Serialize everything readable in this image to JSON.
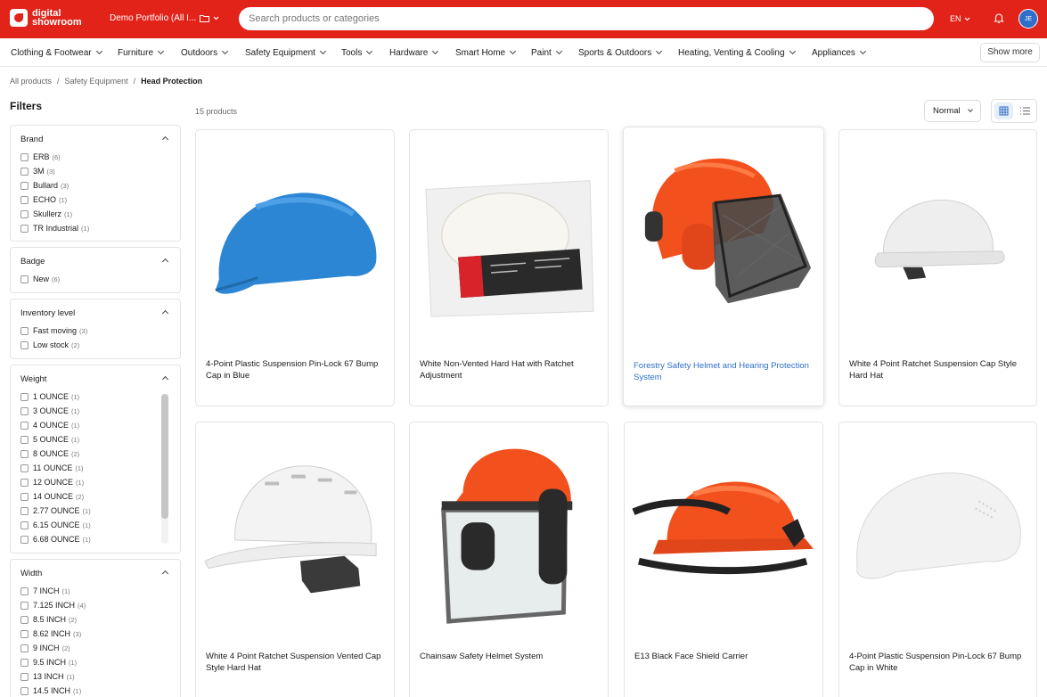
{
  "app": {
    "logo_line1": "digital",
    "logo_line2": "showroom",
    "portfolio": "Demo Portfolio (All I...",
    "search_placeholder": "Search products or categories",
    "language": "EN",
    "avatar_initials": "JE",
    "brand_color": "#e2231a"
  },
  "nav": {
    "categories": [
      "Clothing & Footwear",
      "Furniture",
      "Outdoors",
      "Safety Equipment",
      "Tools",
      "Hardware",
      "Smart Home",
      "Paint",
      "Sports & Outdoors",
      "Heating, Venting & Cooling",
      "Appliances"
    ],
    "show_more": "Show more"
  },
  "breadcrumb": {
    "items": [
      "All products",
      "Safety Equipment",
      "Head Protection"
    ],
    "separator": "/"
  },
  "filters": {
    "title": "Filters",
    "brand": {
      "title": "Brand",
      "options": [
        {
          "label": "ERB",
          "count": "(6)"
        },
        {
          "label": "3M",
          "count": "(3)"
        },
        {
          "label": "Bullard",
          "count": "(3)"
        },
        {
          "label": "ECHO",
          "count": "(1)"
        },
        {
          "label": "Skullerz",
          "count": "(1)"
        },
        {
          "label": "TR Industrial",
          "count": "(1)"
        }
      ]
    },
    "badge": {
      "title": "Badge",
      "options": [
        {
          "label": "New",
          "count": "(6)"
        }
      ]
    },
    "inventory": {
      "title": "Inventory level",
      "options": [
        {
          "label": "Fast moving",
          "count": "(3)"
        },
        {
          "label": "Low stock",
          "count": "(2)"
        }
      ]
    },
    "weight": {
      "title": "Weight",
      "options": [
        {
          "label": "1 OUNCE",
          "count": "(1)"
        },
        {
          "label": "3 OUNCE",
          "count": "(1)"
        },
        {
          "label": "4 OUNCE",
          "count": "(1)"
        },
        {
          "label": "5 OUNCE",
          "count": "(1)"
        },
        {
          "label": "8 OUNCE",
          "count": "(2)"
        },
        {
          "label": "11 OUNCE",
          "count": "(1)"
        },
        {
          "label": "12 OUNCE",
          "count": "(1)"
        },
        {
          "label": "14 OUNCE",
          "count": "(2)"
        },
        {
          "label": "2.77 OUNCE",
          "count": "(1)"
        },
        {
          "label": "6.15 OUNCE",
          "count": "(1)"
        },
        {
          "label": "6.68 OUNCE",
          "count": "(1)"
        }
      ]
    },
    "width": {
      "title": "Width",
      "options": [
        {
          "label": "7 INCH",
          "count": "(1)"
        },
        {
          "label": "7.125 INCH",
          "count": "(4)"
        },
        {
          "label": "8.5 INCH",
          "count": "(2)"
        },
        {
          "label": "8.62 INCH",
          "count": "(3)"
        },
        {
          "label": "9 INCH",
          "count": "(2)"
        },
        {
          "label": "9.5 INCH",
          "count": "(1)"
        },
        {
          "label": "13 INCH",
          "count": "(1)"
        },
        {
          "label": "14.5 INCH",
          "count": "(1)"
        }
      ]
    }
  },
  "results": {
    "count_label": "15 products",
    "sort_value": "Normal",
    "view_mode": "grid"
  },
  "products": [
    {
      "name": "4-Point Plastic Suspension Pin-Lock 67 Bump Cap in Blue",
      "image": "blue-bump-cap",
      "color": "#2d86d3"
    },
    {
      "name": "White Non-Vented Hard Hat with Ratchet Adjustment",
      "image": "hard-hat-in-packaging",
      "color": "#ffffff"
    },
    {
      "name": "Forestry Safety Helmet and Hearing Protection System",
      "image": "orange-forestry-helmet-mesh-visor",
      "color": "#f2501c"
    },
    {
      "name": "White 4 Point Ratchet Suspension Cap Style Hard Hat",
      "image": "white-cap-hard-hat",
      "color": "#ffffff"
    },
    {
      "name": "White 4 Point Ratchet Suspension Vented Cap Style Hard Hat",
      "image": "white-vented-hard-hat",
      "color": "#ffffff"
    },
    {
      "name": "Chainsaw Safety Helmet System",
      "image": "orange-chainsaw-helmet-clear-visor",
      "color": "#f2501c"
    },
    {
      "name": "E13 Black Face Shield Carrier",
      "image": "orange-helmet-black-carrier",
      "color": "#f2501c"
    },
    {
      "name": "4-Point Plastic Suspension Pin-Lock 67 Bump Cap in White",
      "image": "white-bump-cap",
      "color": "#ffffff"
    }
  ]
}
